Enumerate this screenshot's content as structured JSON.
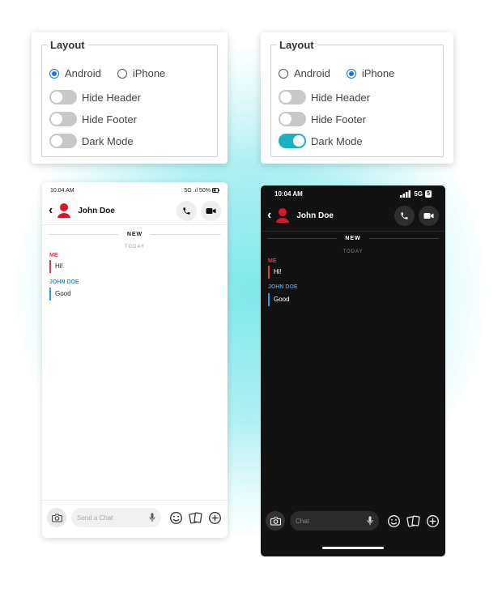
{
  "settings_android": {
    "legend": "Layout",
    "radio": [
      {
        "label": "Android",
        "checked": true
      },
      {
        "label": "iPhone",
        "checked": false
      }
    ],
    "toggles": [
      {
        "label": "Hide Header",
        "on": false
      },
      {
        "label": "Hide Footer",
        "on": false
      },
      {
        "label": "Dark Mode",
        "on": false
      }
    ]
  },
  "settings_iphone": {
    "legend": "Layout",
    "radio": [
      {
        "label": "Android",
        "checked": false
      },
      {
        "label": "iPhone",
        "checked": true
      }
    ],
    "toggles": [
      {
        "label": "Hide Header",
        "on": false
      },
      {
        "label": "Hide Footer",
        "on": false
      },
      {
        "label": "Dark Mode",
        "on": true
      }
    ]
  },
  "android_preview": {
    "status_time": "10:04 AM",
    "status_right": "5G .ıl 50%",
    "contact_name": "John Doe",
    "new_label": "NEW",
    "today_label": "TODAY",
    "messages": [
      {
        "sender": "ME",
        "text": "Hi!",
        "color": "#e8364a"
      },
      {
        "sender": "JOHN DOE",
        "text": "Good",
        "color": "#2d9bdb"
      }
    ],
    "chat_placeholder": "Send a Chat"
  },
  "iphone_preview": {
    "status_time": "10:04 AM",
    "status_network": "5G",
    "status_battery": "5",
    "contact_name": "John Doe",
    "new_label": "NEW",
    "today_label": "TODAY",
    "messages": [
      {
        "sender": "ME",
        "text": "Hi!",
        "color": "#e8364a"
      },
      {
        "sender": "JOHN DOE",
        "text": "Good",
        "color": "#2d9bdb"
      }
    ],
    "chat_placeholder": "Chat"
  },
  "colors": {
    "accent_teal": "#1bb1bf",
    "radio_blue": "#1a73e8",
    "avatar_red": "#d9162b"
  }
}
